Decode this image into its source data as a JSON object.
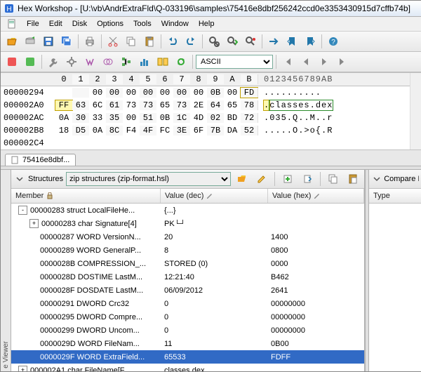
{
  "window": {
    "app_name": "Hex Workshop",
    "doc_path": "[U:\\vb\\AndrExtraFld\\Q-033196\\samples\\75416e8dbf256242ccd0e3353430915d7cffb74b]",
    "title": "Hex Workshop - [U:\\vb\\AndrExtraFld\\Q-033196\\samples\\75416e8dbf256242ccd0e3353430915d7cffb74b]"
  },
  "menu": [
    "File",
    "Edit",
    "Disk",
    "Options",
    "Tools",
    "Window",
    "Help"
  ],
  "encoding": "ASCII",
  "tab_label": "75416e8dbf...",
  "hex": {
    "cols": [
      "0",
      "1",
      "2",
      "3",
      "4",
      "5",
      "6",
      "7",
      "8",
      "9",
      "A",
      "B"
    ],
    "ascii_hdr": "0123456789AB",
    "rows": [
      {
        "addr": "00000294",
        "b": [
          "00",
          "00",
          "00",
          "00",
          "00",
          "00",
          "00",
          "0B",
          "00",
          "FD"
        ],
        "ascii": "..........",
        "pad": 2,
        "hl": [
          {
            "i": 9,
            "c": "y"
          }
        ]
      },
      {
        "addr": "000002A0",
        "b": [
          "FF",
          "63",
          "6C",
          "61",
          "73",
          "73",
          "65",
          "73",
          "2E",
          "64",
          "65",
          "78"
        ],
        "ascii": ".classes.dex",
        "hl": [
          {
            "i": 0,
            "c": "y"
          }
        ],
        "asciiHl": true
      },
      {
        "addr": "000002AC",
        "b": [
          "0A",
          "30",
          "33",
          "35",
          "00",
          "51",
          "0B",
          "1C",
          "4D",
          "02",
          "BD",
          "72"
        ],
        "ascii": ".035.Q..M..r"
      },
      {
        "addr": "000002B8",
        "b": [
          "18",
          "D5",
          "0A",
          "8C",
          "F4",
          "4F",
          "FC",
          "3E",
          "6F",
          "7B",
          "DA",
          "52"
        ],
        "ascii": ".....O.>o{.R"
      },
      {
        "addr": "000002C4",
        "b": [
          "",
          "",
          "",
          "",
          "",
          "",
          "",
          "",
          "",
          "",
          "",
          ""
        ],
        "ascii": ""
      }
    ]
  },
  "structures": {
    "label": "Structures",
    "picker": "zip structures (zip-format.hsl)",
    "cols": {
      "member": "Member",
      "vdec": "Value (dec)",
      "vhex": "Value (hex)"
    },
    "rows": [
      {
        "depth": 0,
        "tw": "-",
        "m": "00000283 struct LocalFileHe...",
        "d": "{...}",
        "h": ""
      },
      {
        "depth": 1,
        "tw": "+",
        "m": "00000283 char Signature[4]",
        "d": "PK└┘",
        "h": ""
      },
      {
        "depth": 1,
        "tw": "",
        "m": "00000287 WORD VersionN...",
        "d": "20",
        "h": "1400"
      },
      {
        "depth": 1,
        "tw": "",
        "m": "00000289 WORD GeneralP...",
        "d": "8",
        "h": "0800"
      },
      {
        "depth": 1,
        "tw": "",
        "m": "0000028B COMPRESSION_...",
        "d": "STORED (0)",
        "h": "0000"
      },
      {
        "depth": 1,
        "tw": "",
        "m": "0000028D DOSTIME LastM...",
        "d": "12:21:40",
        "h": "B462"
      },
      {
        "depth": 1,
        "tw": "",
        "m": "0000028F DOSDATE LastM...",
        "d": "06/09/2012",
        "h": "2641"
      },
      {
        "depth": 1,
        "tw": "",
        "m": "00000291 DWORD Crc32",
        "d": "0",
        "h": "00000000"
      },
      {
        "depth": 1,
        "tw": "",
        "m": "00000295 DWORD Compre...",
        "d": "0",
        "h": "00000000"
      },
      {
        "depth": 1,
        "tw": "",
        "m": "00000299 DWORD Uncom...",
        "d": "0",
        "h": "00000000"
      },
      {
        "depth": 1,
        "tw": "",
        "m": "0000029D WORD FileNam...",
        "d": "11",
        "h": "0B00"
      },
      {
        "depth": 1,
        "tw": "",
        "m": "0000029F WORD ExtraField...",
        "d": "65533",
        "h": "FDFF",
        "sel": true
      },
      {
        "depth": 0,
        "tw": "+",
        "m": "000002A1 char FileName[F...",
        "d": "classes.dex",
        "h": ""
      }
    ]
  },
  "compare": {
    "title": "Compare Re",
    "col": "Type"
  },
  "viewer_label": "e Viewer"
}
